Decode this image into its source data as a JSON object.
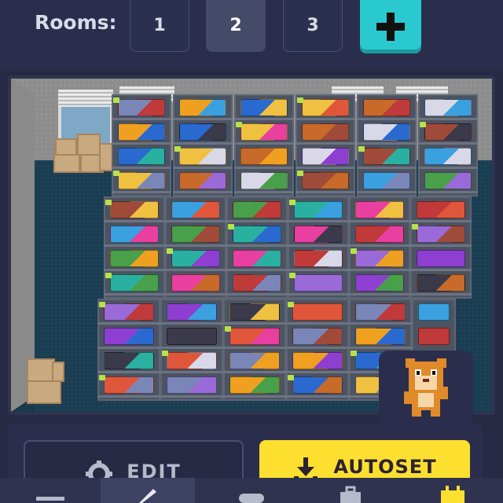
{
  "rooms": {
    "label": "Rooms:",
    "tabs": [
      {
        "label": "1",
        "active": false
      },
      {
        "label": "2",
        "active": true
      },
      {
        "label": "3",
        "active": false
      }
    ],
    "add_icon": "plus-icon"
  },
  "actions": {
    "edit_label": "EDIT",
    "edit_icon": "gear-icon",
    "autoset_label": "AUTOSET",
    "autoset_icon": "download-icon"
  },
  "nav": {
    "items": [
      {
        "icon": "menu-icon",
        "active": false
      },
      {
        "icon": "build-icon",
        "active": true
      },
      {
        "icon": "gamepad-icon",
        "active": false
      },
      {
        "icon": "briefcase-icon",
        "active": false
      },
      {
        "icon": "calendar-icon",
        "active": false
      }
    ]
  },
  "colors": {
    "background": "#262a44",
    "accent_cyan": "#29c9cf",
    "accent_yellow": "#fde02f",
    "floor": "#1b3d52"
  },
  "mascot_icon": "hamster-icon"
}
